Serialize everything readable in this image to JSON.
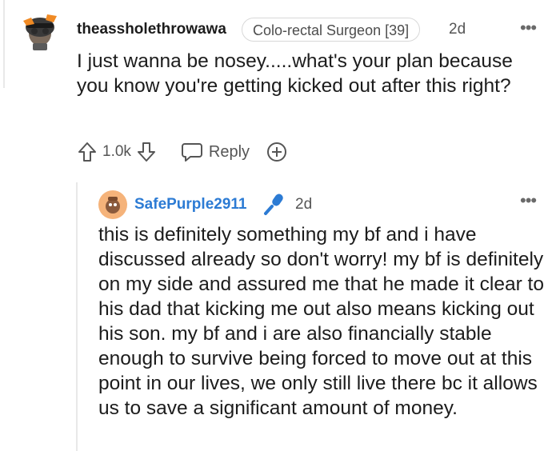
{
  "comment": {
    "username": "theassholethrowawa",
    "flair": "Colo-rectal Surgeon [39]",
    "time": "2d",
    "body": "I just wanna be nosey.....what's your plan because you know you're getting kicked out after this right?",
    "votes": "1.0k",
    "reply_label": "Reply"
  },
  "reply": {
    "username": "SafePurple2911",
    "time": "2d",
    "body": "this is definitely something my bf and i have discussed already so don't worry! my bf is definitely on my side and assured me that he made it clear to his dad that kicking me out also means kicking out his son. my bf and i are also financially stable enough to survive being forced to move out at this point in our lives, we only still live there bc it allows us to save a significant amount of money."
  },
  "icons": {
    "upvote": "upvote-arrow-icon",
    "downvote": "downvote-arrow-icon",
    "reply": "speech-bubble-icon",
    "award": "add-award-icon",
    "more": "more-options-icon",
    "mic": "microphone-icon"
  },
  "colors": {
    "username_op": "#2c7bd4",
    "text": "#1c1c1c",
    "muted": "#555555"
  }
}
